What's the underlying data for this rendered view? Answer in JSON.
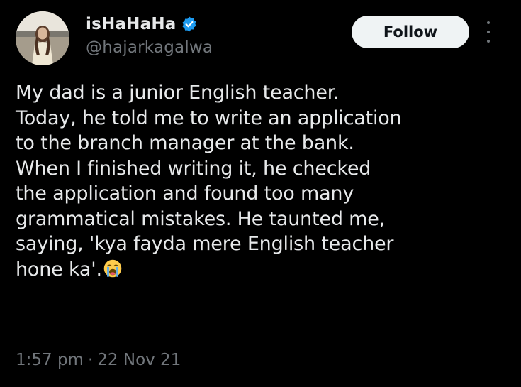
{
  "author": {
    "display_name": "isHaHaHa",
    "handle": "@hajarkagalwa",
    "verified_icon": "verified-badge-icon",
    "verified_color": "#1d9bf0"
  },
  "actions": {
    "follow_label": "Follow",
    "more_icon": "more-horizontal-icon"
  },
  "tweet": {
    "lines": [
      "My dad is a junior English teacher.",
      "Today, he told me to write an application",
      "to the branch manager at the bank.",
      "When I finished writing it, he checked",
      "the application and found too many",
      "grammatical mistakes. He taunted me,",
      "saying, 'kya fayda mere English teacher",
      "hone ka'."
    ],
    "trailing_emoji": "loudly-crying-face-icon",
    "time": "1:57 pm",
    "separator": "·",
    "date": "22 Nov 21"
  },
  "colors": {
    "background": "#000000",
    "text_primary": "#e7e9ea",
    "text_secondary": "#71767b",
    "follow_bg": "#eff3f4",
    "follow_text": "#0f1419"
  }
}
